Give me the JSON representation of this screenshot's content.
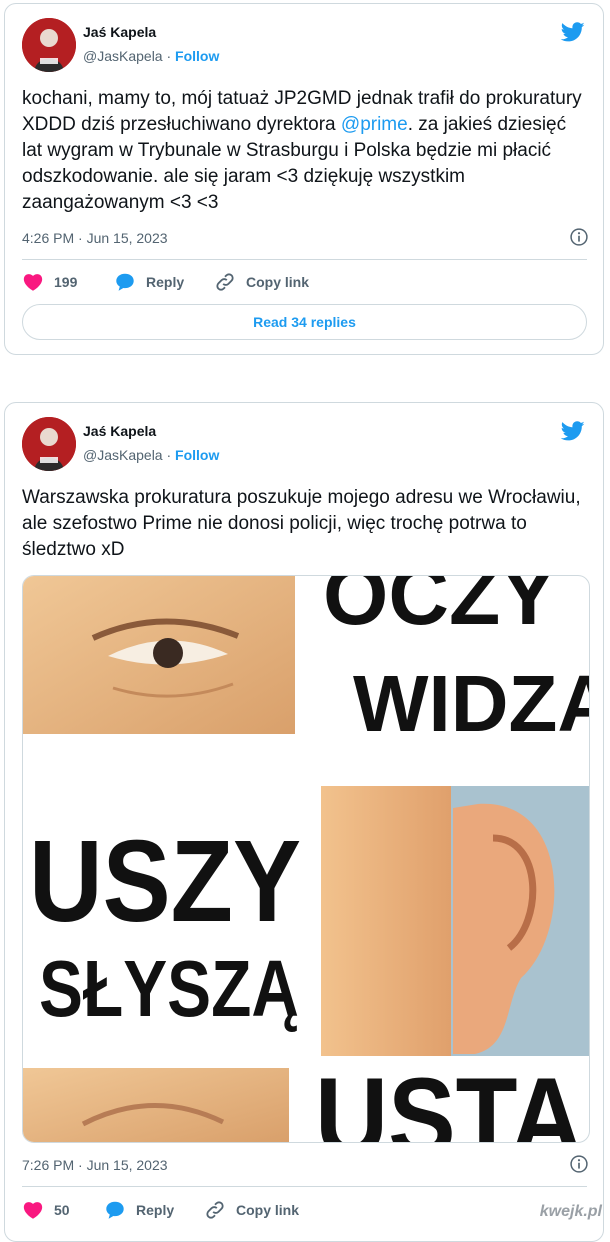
{
  "tweets": [
    {
      "author": "Jaś Kapela",
      "handle": "@JasKapela",
      "separator": "·",
      "follow_label": "Follow",
      "text_before_link": "kochani, mamy to, mój tatuaż JP2GMD jednak trafił do prokuratury XDDD dziś przesłuchiwano dyrektora ",
      "link_text": "@prime",
      "text_after_link": ". za jakieś dziesięć lat wygram w Trybunale w Strasburgu i Polska będzie mi płacić odszkodowanie. ale się jaram <3 dziękuję wszystkim zaangażowanym <3 <3",
      "timestamp": "4:26 PM · Jun 15, 2023",
      "likes": "199",
      "reply_label": "Reply",
      "copy_label": "Copy link",
      "read_replies_label": "Read 34 replies"
    },
    {
      "author": "Jaś Kapela",
      "handle": "@JasKapela",
      "separator": "·",
      "follow_label": "Follow",
      "text": "Warszawska prokuratura poszukuje mojego adresu we Wrocławiu, ale szefostwo Prime nie donosi policji, więc trochę potrwa to śledztwo xD",
      "media": {
        "words": [
          "OCZY",
          "WIDZĄ",
          "USZY",
          "SŁYSZĄ",
          "USTA"
        ]
      },
      "timestamp": "7:26 PM · Jun 15, 2023",
      "likes": "50",
      "reply_label": "Reply",
      "copy_label": "Copy link"
    }
  ],
  "watermark": "kwejk.pl",
  "colors": {
    "accent": "#1d9bf0",
    "heart": "#f91880",
    "muted": "#536471",
    "border": "#cfd9de"
  },
  "icons": [
    "twitter-bird-icon",
    "info-icon",
    "heart-icon",
    "reply-bubble-icon",
    "copy-link-icon"
  ]
}
